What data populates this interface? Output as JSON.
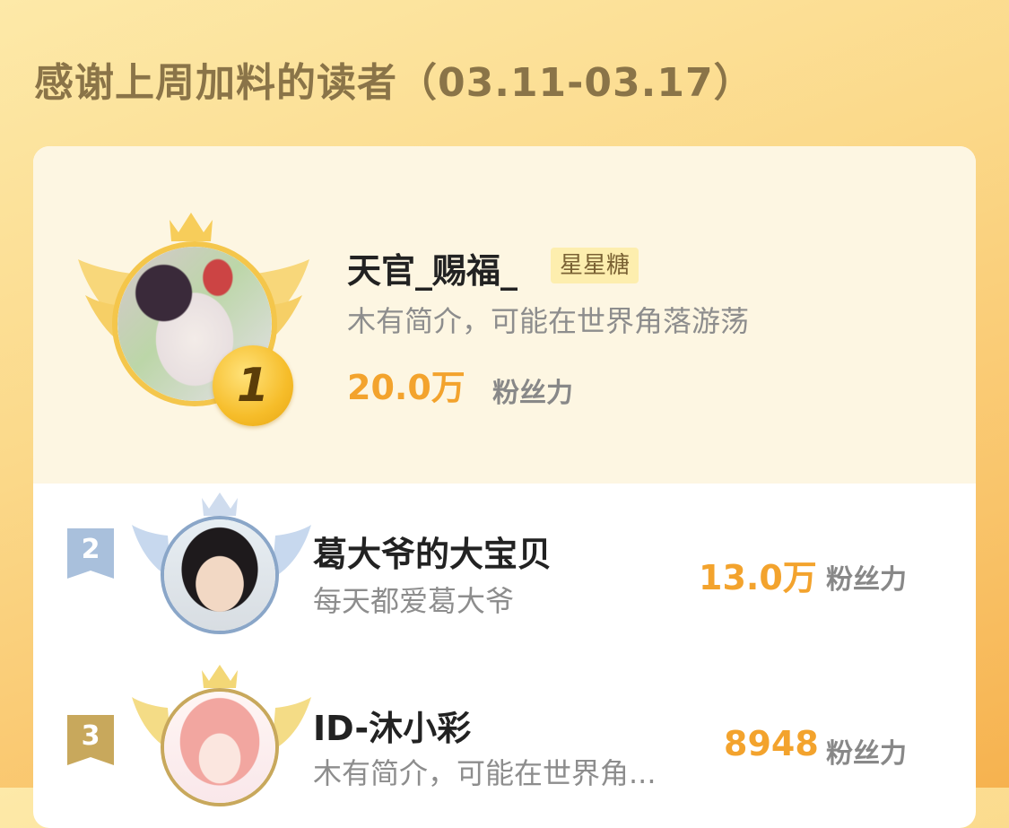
{
  "title": "感谢上周加料的读者（03.11-03.17）",
  "readers": [
    {
      "rank": "1",
      "name": "天官_赐福_",
      "badge": "星星糖",
      "desc": "木有简介，可能在世界角落游荡",
      "fans": "20.0万",
      "fans_unit": "粉丝力"
    },
    {
      "rank": "2",
      "name": "葛大爷的大宝贝",
      "desc": "每天都爱葛大爷",
      "fans": "13.0万",
      "fans_unit": "粉丝力"
    },
    {
      "rank": "3",
      "name": "ID-沐小彩",
      "desc": "木有简介，可能在世界角...",
      "fans": "8948",
      "fans_unit": "粉丝力"
    }
  ],
  "colors": {
    "accent": "#f3a32d",
    "silver": "#a9c0dc",
    "bronze": "#c8a85c",
    "gold": "#f6bd2a"
  }
}
